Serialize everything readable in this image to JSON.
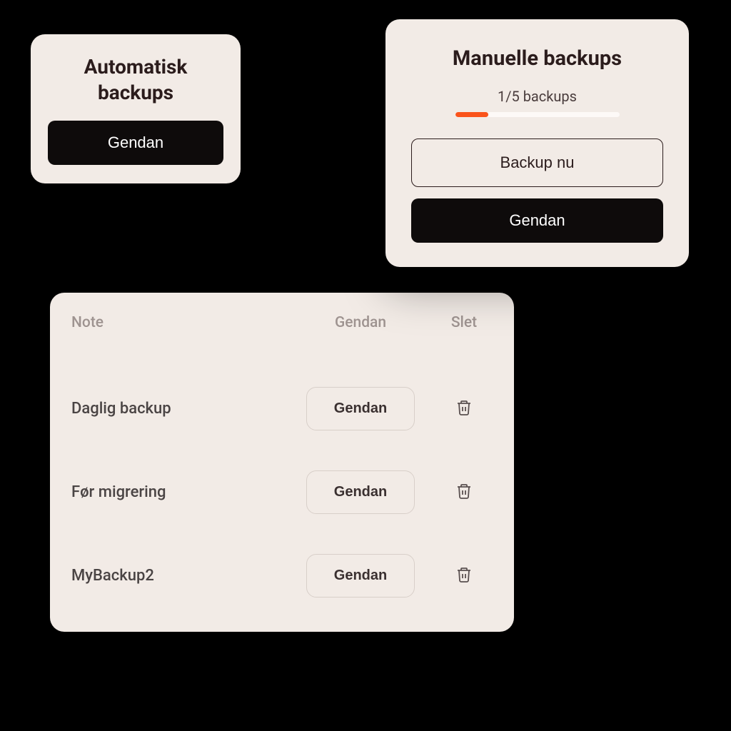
{
  "auto": {
    "title_line1": "Automatisk",
    "title_line2": "backups",
    "restore_label": "Gendan"
  },
  "manual": {
    "title": "Manuelle backups",
    "progress_label": "1/5 backups",
    "progress_percent": 20,
    "backup_now_label": "Backup nu",
    "restore_label": "Gendan"
  },
  "table": {
    "headers": {
      "note": "Note",
      "restore": "Gendan",
      "delete": "Slet"
    },
    "rows": [
      {
        "note": "Daglig backup",
        "restore": "Gendan"
      },
      {
        "note": "Før migrering",
        "restore": "Gendan"
      },
      {
        "note": "MyBackup2",
        "restore": "Gendan"
      }
    ]
  },
  "colors": {
    "card_bg": "#f2ebe6",
    "accent": "#fa531b",
    "dark": "#0e0b0b"
  }
}
